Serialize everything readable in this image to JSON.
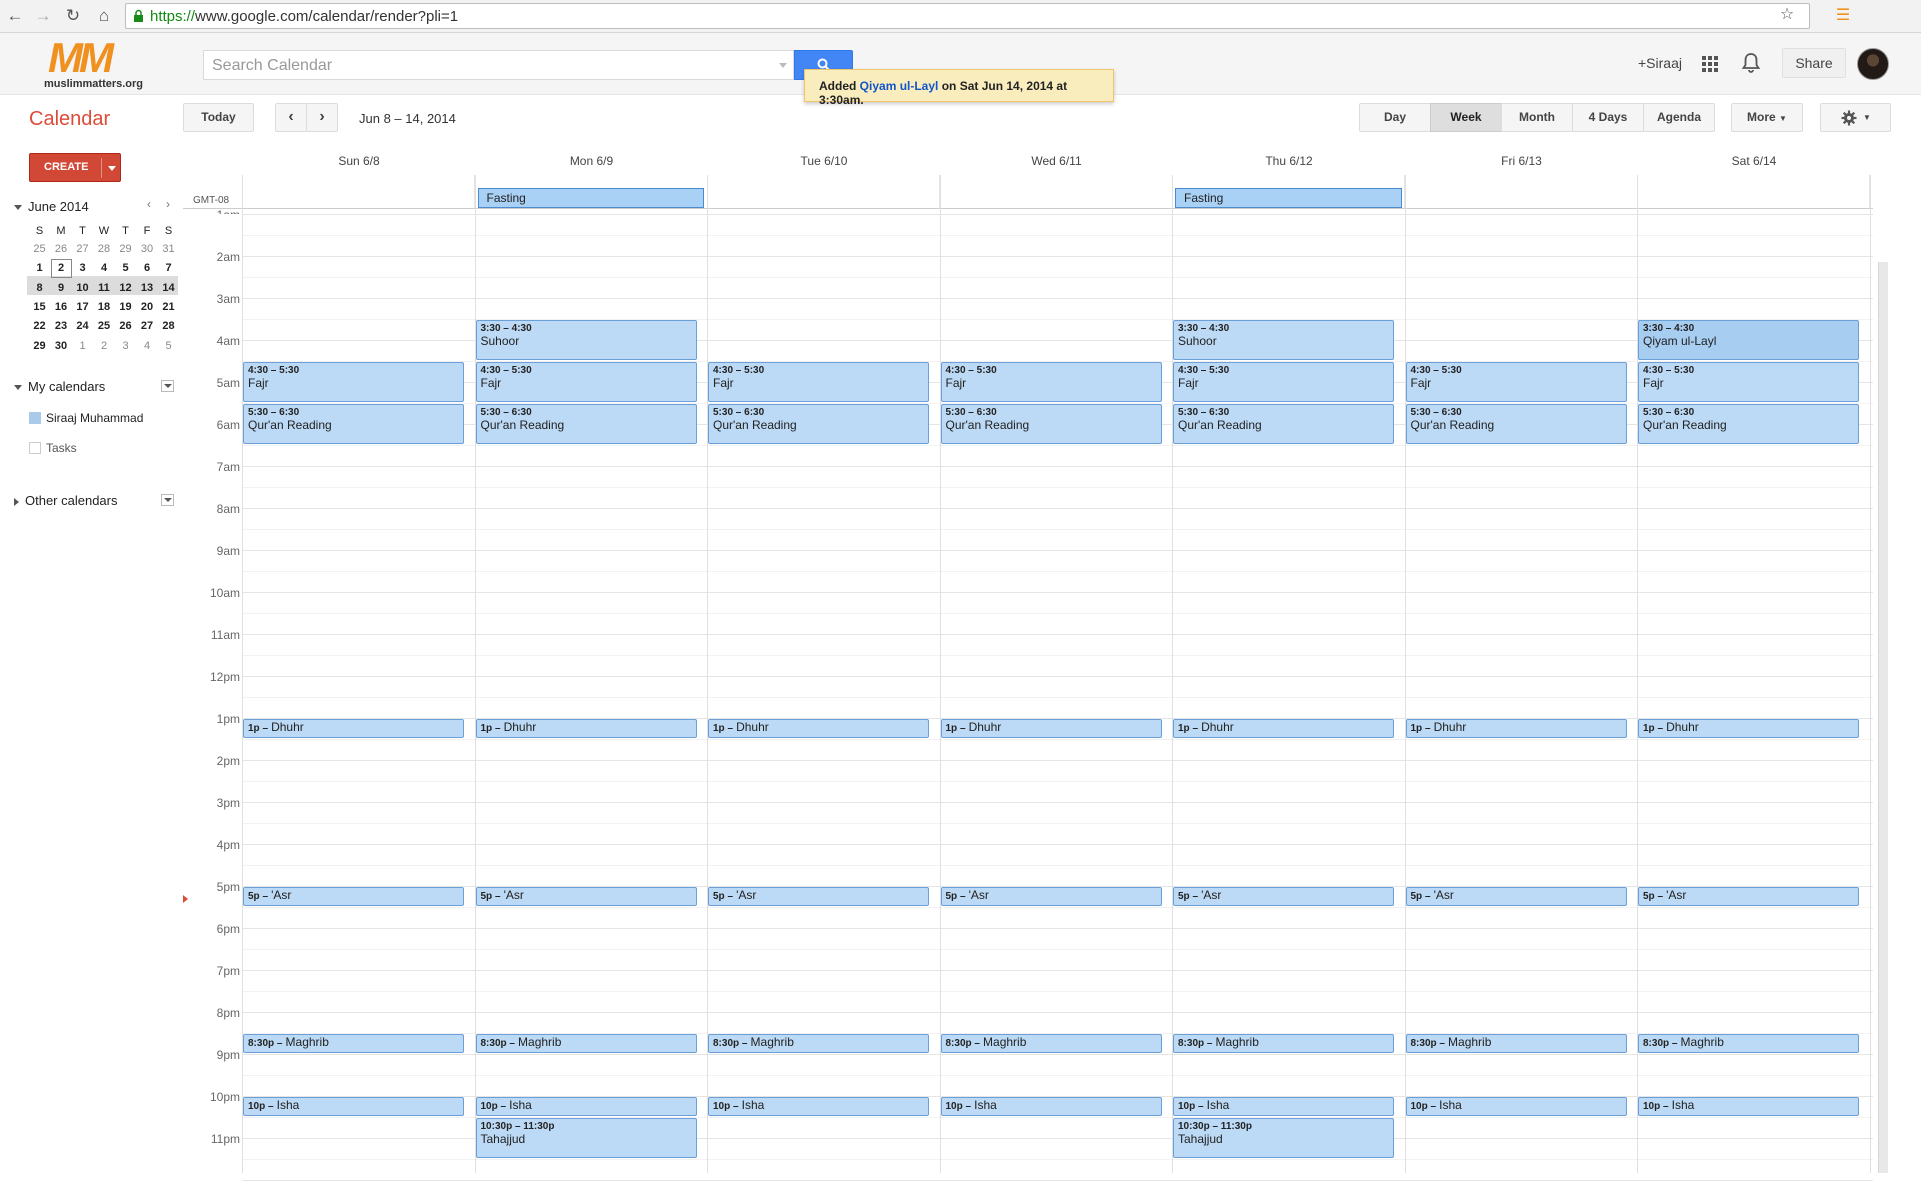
{
  "browser": {
    "url_scheme": "https://",
    "url_rest": "www.google.com/calendar/render?pli=1"
  },
  "header": {
    "logo_text": "MM",
    "logo_site": "muslimmatters.org",
    "search_placeholder": "Search Calendar",
    "user_name": "+Siraaj",
    "share_label": "Share"
  },
  "notification": {
    "prefix": "Added ",
    "event_link": "Qiyam ul-Layl",
    "suffix": " on Sat Jun 14, 2014 at 3:30am."
  },
  "toolbar": {
    "app_title": "Calendar",
    "today_label": "Today",
    "date_range": "Jun 8 – 14, 2014",
    "views": [
      "Day",
      "Week",
      "Month",
      "4 Days",
      "Agenda"
    ],
    "selected_view": "Week",
    "more_label": "More"
  },
  "sidebar": {
    "create_label": "CREATE",
    "mini_month": "June 2014",
    "weekday_initials": [
      "S",
      "M",
      "T",
      "W",
      "T",
      "F",
      "S"
    ],
    "mini_weeks": [
      [
        "25",
        "26",
        "27",
        "28",
        "29",
        "30",
        "31"
      ],
      [
        "1",
        "2",
        "3",
        "4",
        "5",
        "6",
        "7"
      ],
      [
        "8",
        "9",
        "10",
        "11",
        "12",
        "13",
        "14"
      ],
      [
        "15",
        "16",
        "17",
        "18",
        "19",
        "20",
        "21"
      ],
      [
        "22",
        "23",
        "24",
        "25",
        "26",
        "27",
        "28"
      ],
      [
        "29",
        "30",
        "1",
        "2",
        "3",
        "4",
        "5"
      ]
    ],
    "my_calendars_label": "My calendars",
    "calendars": [
      {
        "name": "Siraaj Muhammad",
        "color": "#a9cbe9"
      },
      {
        "name": "Tasks",
        "color": "#ffffff"
      }
    ],
    "other_calendars_label": "Other calendars"
  },
  "grid": {
    "timezone": "GMT-08",
    "days": [
      "Sun 6/8",
      "Mon 6/9",
      "Tue 6/10",
      "Wed 6/11",
      "Thu 6/12",
      "Fri 6/13",
      "Sat 6/14"
    ],
    "top_hour_partial": "1am",
    "hours": [
      "2am",
      "3am",
      "4am",
      "5am",
      "6am",
      "7am",
      "8am",
      "9am",
      "10am",
      "11am",
      "12pm",
      "1pm",
      "2pm",
      "3pm",
      "4pm",
      "5pm",
      "6pm",
      "7pm",
      "8pm",
      "9pm",
      "10pm",
      "11pm"
    ],
    "allday_events": [
      {
        "day": 1,
        "title": "Fasting"
      },
      {
        "day": 4,
        "title": "Fasting"
      }
    ],
    "events": [
      {
        "day": 1,
        "start": 3.5,
        "end": 4.5,
        "time": "3:30 – 4:30",
        "title": "Suhoor"
      },
      {
        "day": 4,
        "start": 3.5,
        "end": 4.5,
        "time": "3:30 – 4:30",
        "title": "Suhoor"
      },
      {
        "day": 6,
        "start": 3.5,
        "end": 4.5,
        "time": "3:30 – 4:30",
        "title": "Qiyam ul-Layl",
        "highlight": true
      },
      {
        "day": 0,
        "start": 4.5,
        "end": 5.5,
        "time": "4:30 – 5:30",
        "title": "Fajr"
      },
      {
        "day": 1,
        "start": 4.5,
        "end": 5.5,
        "time": "4:30 – 5:30",
        "title": "Fajr"
      },
      {
        "day": 2,
        "start": 4.5,
        "end": 5.5,
        "time": "4:30 – 5:30",
        "title": "Fajr"
      },
      {
        "day": 3,
        "start": 4.5,
        "end": 5.5,
        "time": "4:30 – 5:30",
        "title": "Fajr"
      },
      {
        "day": 4,
        "start": 4.5,
        "end": 5.5,
        "time": "4:30 – 5:30",
        "title": "Fajr"
      },
      {
        "day": 5,
        "start": 4.5,
        "end": 5.5,
        "time": "4:30 – 5:30",
        "title": "Fajr"
      },
      {
        "day": 6,
        "start": 4.5,
        "end": 5.5,
        "time": "4:30 – 5:30",
        "title": "Fajr"
      },
      {
        "day": 0,
        "start": 5.5,
        "end": 6.5,
        "time": "5:30 – 6:30",
        "title": "Qur'an Reading"
      },
      {
        "day": 1,
        "start": 5.5,
        "end": 6.5,
        "time": "5:30 – 6:30",
        "title": "Qur'an Reading"
      },
      {
        "day": 2,
        "start": 5.5,
        "end": 6.5,
        "time": "5:30 – 6:30",
        "title": "Qur'an Reading"
      },
      {
        "day": 3,
        "start": 5.5,
        "end": 6.5,
        "time": "5:30 – 6:30",
        "title": "Qur'an Reading"
      },
      {
        "day": 4,
        "start": 5.5,
        "end": 6.5,
        "time": "5:30 – 6:30",
        "title": "Qur'an Reading"
      },
      {
        "day": 5,
        "start": 5.5,
        "end": 6.5,
        "time": "5:30 – 6:30",
        "title": "Qur'an Reading"
      },
      {
        "day": 6,
        "start": 5.5,
        "end": 6.5,
        "time": "5:30 – 6:30",
        "title": "Qur'an Reading"
      },
      {
        "day": 0,
        "start": 13,
        "oneline": true,
        "time": "1p –",
        "title": "Dhuhr"
      },
      {
        "day": 1,
        "start": 13,
        "oneline": true,
        "time": "1p –",
        "title": "Dhuhr"
      },
      {
        "day": 2,
        "start": 13,
        "oneline": true,
        "time": "1p –",
        "title": "Dhuhr"
      },
      {
        "day": 3,
        "start": 13,
        "oneline": true,
        "time": "1p –",
        "title": "Dhuhr"
      },
      {
        "day": 4,
        "start": 13,
        "oneline": true,
        "time": "1p –",
        "title": "Dhuhr"
      },
      {
        "day": 5,
        "start": 13,
        "oneline": true,
        "time": "1p –",
        "title": "Dhuhr"
      },
      {
        "day": 6,
        "start": 13,
        "oneline": true,
        "time": "1p –",
        "title": "Dhuhr"
      },
      {
        "day": 0,
        "start": 17,
        "oneline": true,
        "time": "5p –",
        "title": "'Asr"
      },
      {
        "day": 1,
        "start": 17,
        "oneline": true,
        "time": "5p –",
        "title": "'Asr"
      },
      {
        "day": 2,
        "start": 17,
        "oneline": true,
        "time": "5p –",
        "title": "'Asr"
      },
      {
        "day": 3,
        "start": 17,
        "oneline": true,
        "time": "5p –",
        "title": "'Asr"
      },
      {
        "day": 4,
        "start": 17,
        "oneline": true,
        "time": "5p –",
        "title": "'Asr"
      },
      {
        "day": 5,
        "start": 17,
        "oneline": true,
        "time": "5p –",
        "title": "'Asr"
      },
      {
        "day": 6,
        "start": 17,
        "oneline": true,
        "time": "5p –",
        "title": "'Asr"
      },
      {
        "day": 0,
        "start": 20.5,
        "oneline": true,
        "time": "8:30p –",
        "title": "Maghrib"
      },
      {
        "day": 1,
        "start": 20.5,
        "oneline": true,
        "time": "8:30p –",
        "title": "Maghrib"
      },
      {
        "day": 2,
        "start": 20.5,
        "oneline": true,
        "time": "8:30p –",
        "title": "Maghrib"
      },
      {
        "day": 3,
        "start": 20.5,
        "oneline": true,
        "time": "8:30p –",
        "title": "Maghrib"
      },
      {
        "day": 4,
        "start": 20.5,
        "oneline": true,
        "time": "8:30p –",
        "title": "Maghrib"
      },
      {
        "day": 5,
        "start": 20.5,
        "oneline": true,
        "time": "8:30p –",
        "title": "Maghrib"
      },
      {
        "day": 6,
        "start": 20.5,
        "oneline": true,
        "time": "8:30p –",
        "title": "Maghrib"
      },
      {
        "day": 0,
        "start": 22,
        "oneline": true,
        "time": "10p –",
        "title": "Isha"
      },
      {
        "day": 1,
        "start": 22,
        "oneline": true,
        "time": "10p –",
        "title": "Isha"
      },
      {
        "day": 2,
        "start": 22,
        "oneline": true,
        "time": "10p –",
        "title": "Isha"
      },
      {
        "day": 3,
        "start": 22,
        "oneline": true,
        "time": "10p –",
        "title": "Isha"
      },
      {
        "day": 4,
        "start": 22,
        "oneline": true,
        "time": "10p –",
        "title": "Isha"
      },
      {
        "day": 5,
        "start": 22,
        "oneline": true,
        "time": "10p –",
        "title": "Isha"
      },
      {
        "day": 6,
        "start": 22,
        "oneline": true,
        "time": "10p –",
        "title": "Isha"
      },
      {
        "day": 1,
        "start": 22.5,
        "end": 23.5,
        "time": "10:30p – 11:30p",
        "title": "Tahajjud"
      },
      {
        "day": 4,
        "start": 22.5,
        "end": 23.5,
        "time": "10:30p – 11:30p",
        "title": "Tahajjud"
      }
    ]
  },
  "colors": {
    "event_bg": "#bcdaf5",
    "event_border": "#6a9fd8",
    "brand_red": "#dd4b39",
    "search_blue": "#4285f4"
  }
}
